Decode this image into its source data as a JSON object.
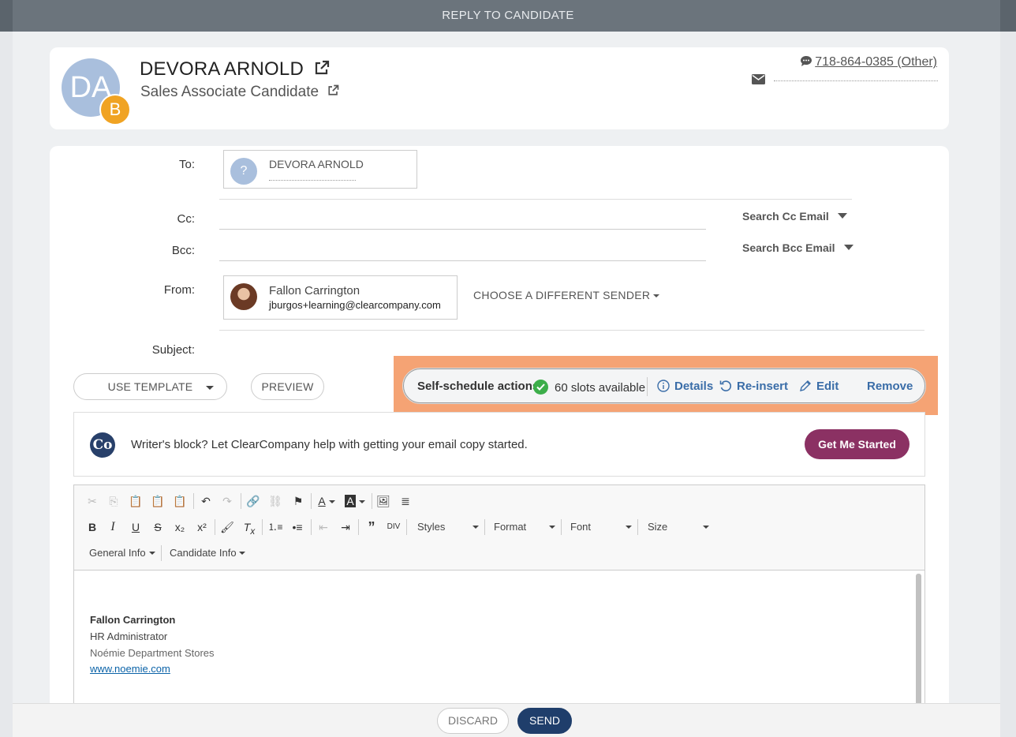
{
  "modal": {
    "title": "REPLY TO CANDIDATE"
  },
  "candidate": {
    "initials": "DA",
    "badge": "B",
    "name": "DEVORA ARNOLD",
    "job": "Sales Associate Candidate",
    "phone": "718-864-0385 (Other)"
  },
  "form": {
    "to_label": "To:",
    "to": {
      "avatar": "?",
      "name": "DEVORA ARNOLD"
    },
    "cc_label": "Cc:",
    "cc_search": "Search Cc Email",
    "bcc_label": "Bcc:",
    "bcc_search": "Search Bcc Email",
    "from_label": "From:",
    "from": {
      "name": "Fallon Carrington",
      "email": "jburgos+learning@clearcompany.com"
    },
    "choose_sender": "CHOOSE A DIFFERENT SENDER",
    "subject_label": "Subject:"
  },
  "actions": {
    "use_template": "USE TEMPLATE",
    "preview": "PREVIEW"
  },
  "self_schedule": {
    "title": "Self-schedule actions:",
    "slots": "60 slots available",
    "details": "Details",
    "reinsert": "Re-insert",
    "edit": "Edit",
    "remove": "Remove",
    "highlight_color": "#f5a374"
  },
  "ai_helper": {
    "logo": "Co",
    "text": "Writer's block? Let ClearCompany help with getting your email copy started.",
    "button": "Get Me Started",
    "button_color": "#8b3163"
  },
  "editor": {
    "styles": "Styles",
    "format": "Format",
    "font": "Font",
    "size": "Size",
    "general_info": "General Info",
    "candidate_info": "Candidate Info",
    "signature": {
      "name": "Fallon Carrington",
      "title": "HR Administrator",
      "company": "Noémie Department Stores",
      "website": "www.noemie.com "
    }
  },
  "footer": {
    "discard": "DISCARD",
    "send": "SEND",
    "send_color": "#1f3e6b"
  }
}
